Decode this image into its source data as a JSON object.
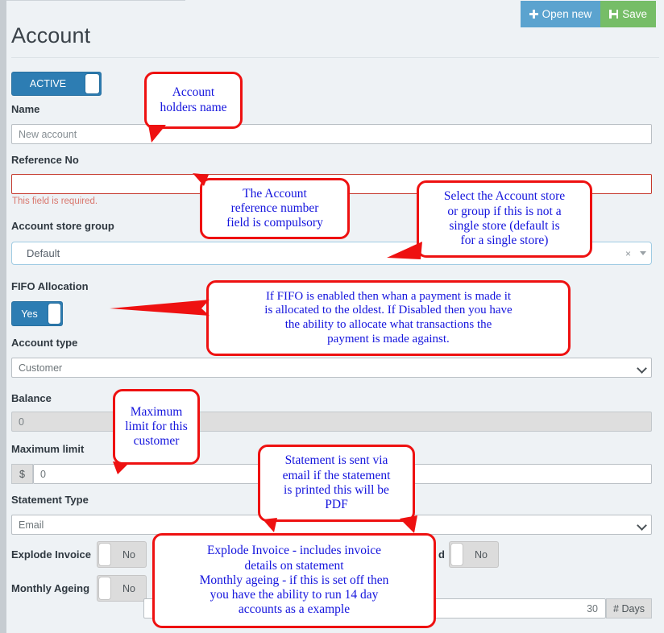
{
  "header": {
    "title": "Account",
    "open_new_label": "Open new",
    "save_label": "Save",
    "plus_icon": "plus-icon",
    "save_icon": "floppy-disk-save-icon"
  },
  "status_toggle": {
    "label": "ACTIVE",
    "state": "on"
  },
  "form": {
    "name": {
      "label": "Name",
      "placeholder": "New account",
      "value": ""
    },
    "reference_no": {
      "label": "Reference No",
      "value": "",
      "error": "This field is required.",
      "required": true
    },
    "account_store_group": {
      "label": "Account store group",
      "value": "Default",
      "clear_icon": "×",
      "options": [
        "Default"
      ]
    },
    "fifo_allocation": {
      "label": "FIFO Allocation",
      "toggle_label": "Yes",
      "state": "on"
    },
    "account_type": {
      "label": "Account type",
      "value": "Customer",
      "options": [
        "Customer"
      ]
    },
    "balance": {
      "label": "Balance",
      "value": "0",
      "disabled": true
    },
    "maximum_limit": {
      "label": "Maximum limit",
      "prefix": "$",
      "value": "0"
    },
    "statement_type": {
      "label": "Statement Type",
      "value": "Email",
      "options": [
        "Email"
      ]
    },
    "explode_invoice": {
      "label": "Explode Invoice",
      "toggle_label": "No",
      "state": "off"
    },
    "monthly_ageing": {
      "label": "Monthly Ageing",
      "toggle_label": "No",
      "state": "off"
    },
    "hidden_toggle_right": {
      "label": "d",
      "toggle_label": "No",
      "state": "off"
    },
    "days_field": {
      "value": "30",
      "suffix": "# Days"
    }
  },
  "annotations": {
    "name": "Account\nholders name",
    "reference": "The Account\nreference number\nfield is compulsory",
    "store_group": "Select the Account store\nor group if this is not a\nsingle store (default is\nfor a single store)",
    "fifo": "If FIFO is enabled then whan a payment is made it\nis allocated to the oldest.  If Disabled then you have\nthe ability to allocate what transactions the\npayment is made against.",
    "max_limit": "Maximum\nlimit for this\ncustomer",
    "statement": "Statement is sent via\nemail if the statement\nis printed this will be\nPDF",
    "explode": "Explode Invoice - includes invoice\ndetails on statement\nMonthly ageing - if this is set off then\nyou have the ability to run 14 day\naccounts as a example"
  },
  "colors": {
    "page_bg": "#eef2f5",
    "toggle_on": "#2d7db3",
    "toggle_off": "#dcdcdc",
    "btn_open": "#5ba3cf",
    "btn_save": "#76bd67",
    "error": "#c5392d",
    "annotation_border": "#ee1111",
    "annotation_text": "#1414dd"
  }
}
